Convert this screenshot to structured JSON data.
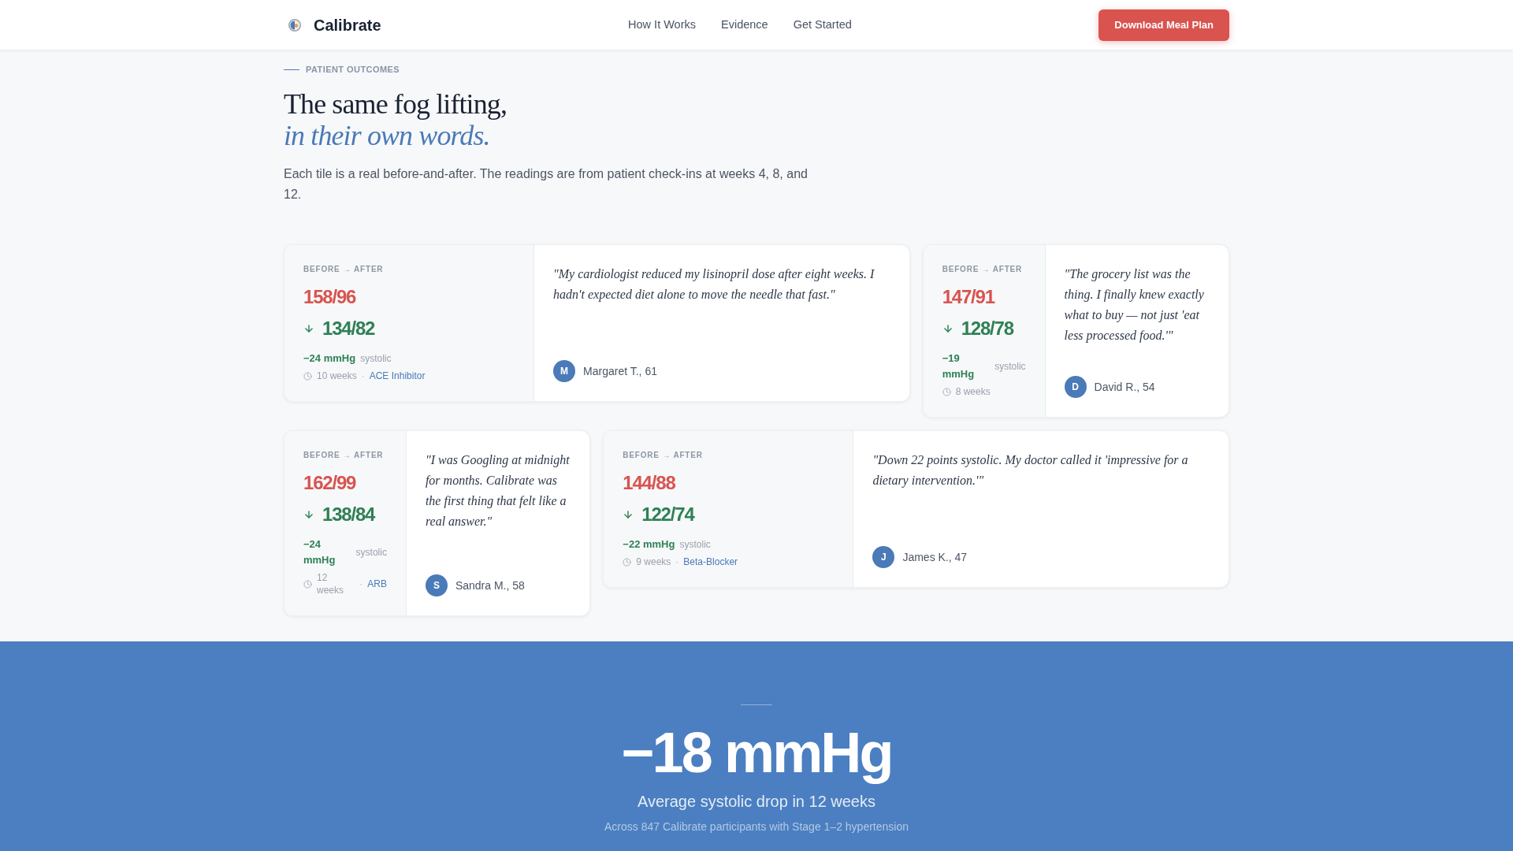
{
  "header": {
    "brand": "Calibrate",
    "nav": [
      {
        "label": "How It Works"
      },
      {
        "label": "Evidence"
      },
      {
        "label": "Get Started"
      }
    ],
    "cta": "Download Meal Plan"
  },
  "intro": {
    "eyebrow": "PATIENT OUTCOMES",
    "title": "The same fog lifting,",
    "title_accent": "in their own words.",
    "description": "Each tile is a real before-and-after. The readings are from patient check-ins at weeks 4, 8, and 12."
  },
  "testimonials": [
    {
      "label": "BEFORE → AFTER",
      "before": "158/96",
      "after": "134/82",
      "change": "−24 mmHg",
      "change_label": "systolic",
      "duration": "10 weeks",
      "separator": "·",
      "medication": "ACE Inhibitor",
      "quote": "\"My cardiologist reduced my lisinopril dose after eight weeks. I hadn't expected diet alone to move the needle that fast.\"",
      "initial": "M",
      "author": "Margaret T., 61"
    },
    {
      "label": "BEFORE → AFTER",
      "before": "147/91",
      "after": "128/78",
      "change": "−19 mmHg",
      "change_label": "systolic",
      "duration": "8 weeks",
      "quote": "\"The grocery list was the thing. I finally knew exactly what to buy — not just 'eat less processed food.'\"",
      "initial": "D",
      "author": "David R., 54"
    },
    {
      "label": "BEFORE → AFTER",
      "before": "162/99",
      "after": "138/84",
      "change": "−24 mmHg",
      "change_label": "systolic",
      "duration": "12 weeks",
      "separator": "·",
      "medication": "ARB",
      "quote": "\"I was Googling at midnight for months. Calibrate was the first thing that felt like a real answer.\"",
      "initial": "S",
      "author": "Sandra M., 58"
    },
    {
      "label": "BEFORE → AFTER",
      "before": "144/88",
      "after": "122/74",
      "change": "−22 mmHg",
      "change_label": "systolic",
      "duration": "9 weeks",
      "separator": "·",
      "medication": "Beta-Blocker",
      "quote": "\"Down 22 points systolic. My doctor called it 'impressive for a dietary intervention.'\"",
      "initial": "J",
      "author": "James K., 47"
    }
  ],
  "summary": {
    "value": "−18 mmHg",
    "caption": "Average systolic drop in 12 weeks",
    "note": "Across 847 Calibrate participants with Stage 1–2 hypertension"
  }
}
